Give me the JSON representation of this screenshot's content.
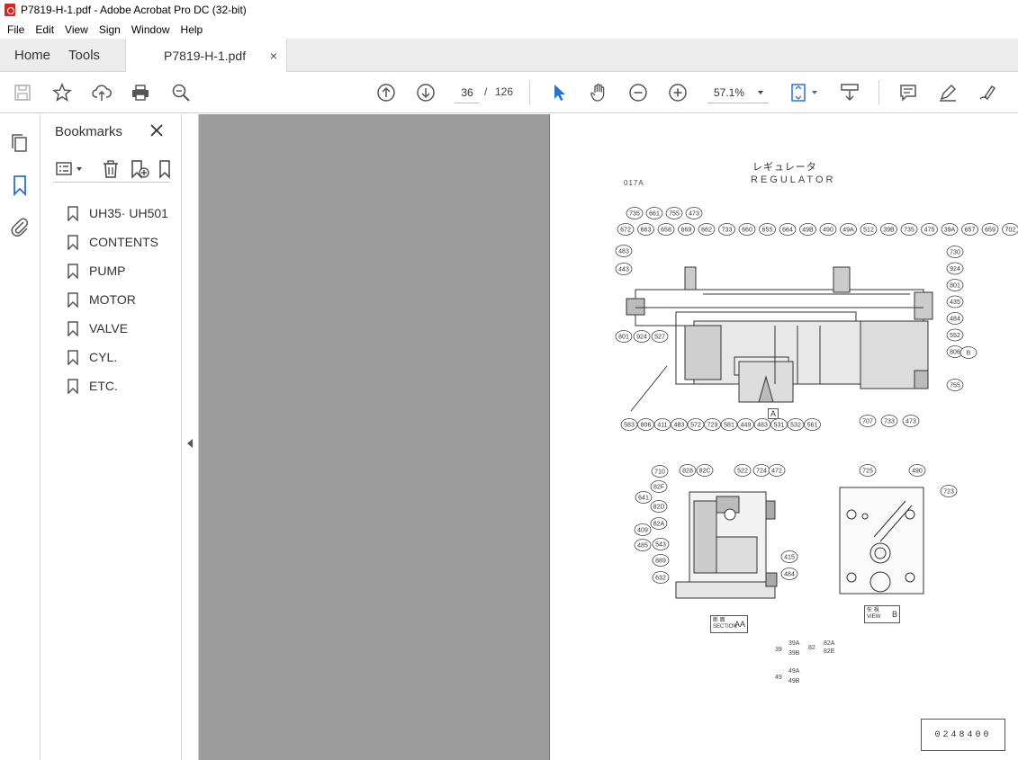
{
  "window": {
    "title": "P7819-H-1.pdf - Adobe Acrobat Pro DC (32-bit)"
  },
  "menu": [
    "File",
    "Edit",
    "View",
    "Sign",
    "Window",
    "Help"
  ],
  "tabs": {
    "home": "Home",
    "tools": "Tools",
    "document": "P7819-H-1.pdf",
    "close": "×"
  },
  "toolbar": {
    "page_current": "36",
    "page_separator": "/",
    "page_total": "126",
    "zoom": "57.1%"
  },
  "bookmarks": {
    "title": "Bookmarks",
    "items": [
      {
        "label": "UH35· UH501"
      },
      {
        "label": "CONTENTS"
      },
      {
        "label": "PUMP"
      },
      {
        "label": "MOTOR"
      },
      {
        "label": "VALVE"
      },
      {
        "label": "CYL."
      },
      {
        "label": "ETC."
      }
    ]
  },
  "document_page": {
    "title_jp": "レギュレータ",
    "title_en": "REGULATOR",
    "code": "017A",
    "doc_number": "0248400",
    "section_label": "断 面 SECTION",
    "section_id": "AA",
    "view_label": "矢 視 VIEW",
    "view_id": "B",
    "arrow_label": "A",
    "legend_39": "39",
    "legend_39a": "39A",
    "legend_39b": "39B",
    "legend_82": "82",
    "legend_82a": "82A",
    "legend_82e": "82E",
    "legend_49": "49",
    "legend_49a": "49A",
    "legend_49b": "49B",
    "callouts_top": [
      "735",
      "661",
      "755",
      "473",
      "672",
      "663",
      "658",
      "669",
      "662",
      "733",
      "660",
      "655",
      "664",
      "49B",
      "490",
      "49A",
      "512",
      "39B",
      "735",
      "475",
      "39A",
      "657",
      "659",
      "702"
    ],
    "callouts_left": [
      "483",
      "443",
      "801",
      "924",
      "527"
    ],
    "callouts_right": [
      "730",
      "924",
      "801",
      "435",
      "484",
      "552",
      "806",
      "B",
      "755"
    ],
    "callouts_bottom": [
      "583",
      "806",
      "411",
      "483",
      "572",
      "729",
      "581",
      "449",
      "483",
      "531",
      "532",
      "561",
      "707",
      "733",
      "473"
    ],
    "callouts_section": [
      "710",
      "828",
      "82C",
      "522",
      "724",
      "472",
      "82F",
      "641",
      "82D",
      "82A",
      "409",
      "485",
      "543",
      "889",
      "632",
      "415",
      "484"
    ],
    "callouts_view": [
      "725",
      "490",
      "723"
    ]
  }
}
